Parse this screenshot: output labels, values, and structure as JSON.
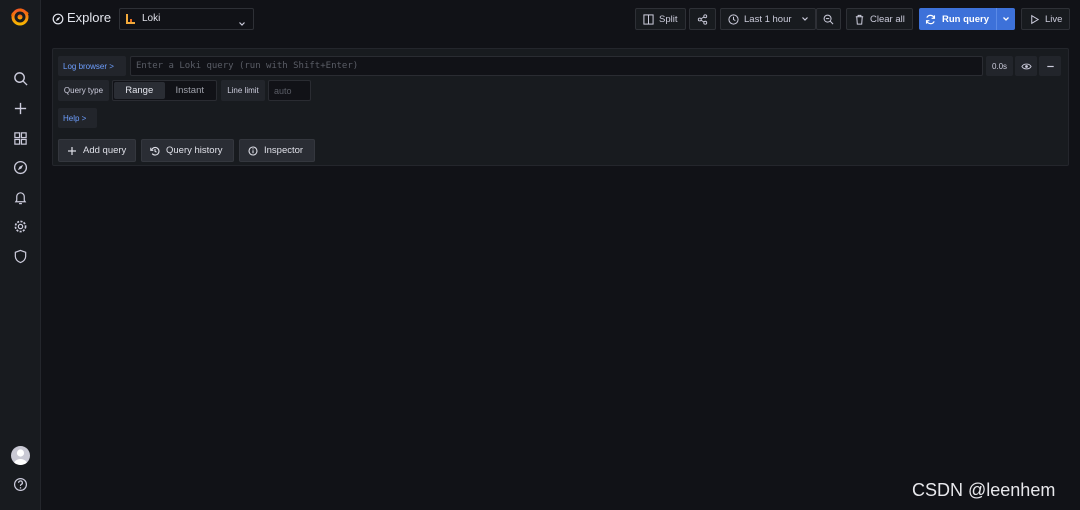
{
  "app": {
    "title": "Explore",
    "logo": "grafana-logo"
  },
  "sidebar": {
    "items": [
      {
        "name": "search",
        "icon": "search-icon"
      },
      {
        "name": "create",
        "icon": "plus-icon"
      },
      {
        "name": "dashboards",
        "icon": "grid-icon"
      },
      {
        "name": "explore",
        "icon": "compass-icon"
      },
      {
        "name": "alerting",
        "icon": "bell-icon"
      },
      {
        "name": "configuration",
        "icon": "gear-icon"
      },
      {
        "name": "server-admin",
        "icon": "shield-icon"
      }
    ],
    "bottom": [
      {
        "name": "profile",
        "icon": "avatar"
      },
      {
        "name": "help",
        "icon": "question-icon"
      }
    ]
  },
  "datasource": {
    "selected": "Loki",
    "icon": "loki-icon"
  },
  "toolbar": {
    "split": "Split",
    "time_range": "Last 1 hour",
    "clear_all": "Clear all",
    "run_query": "Run query",
    "live": "Live"
  },
  "query": {
    "log_browser": "Log browser >",
    "placeholder": "Enter a Loki query (run with Shift+Enter)",
    "value": "",
    "time": "0.0s",
    "query_type_label": "Query type",
    "query_type_options": [
      "Range",
      "Instant"
    ],
    "query_type_selected": "Range",
    "line_limit_label": "Line limit",
    "line_limit_placeholder": "auto",
    "help": "Help >"
  },
  "actions": {
    "add_query": "Add query",
    "query_history": "Query history",
    "inspector": "Inspector"
  },
  "colors": {
    "background": "#111217",
    "panel": "#181b1f",
    "primary": "#3d71d9",
    "link": "#6e9fff",
    "logo_orange": "#f46800"
  },
  "watermark": "CSDN @leenhem"
}
